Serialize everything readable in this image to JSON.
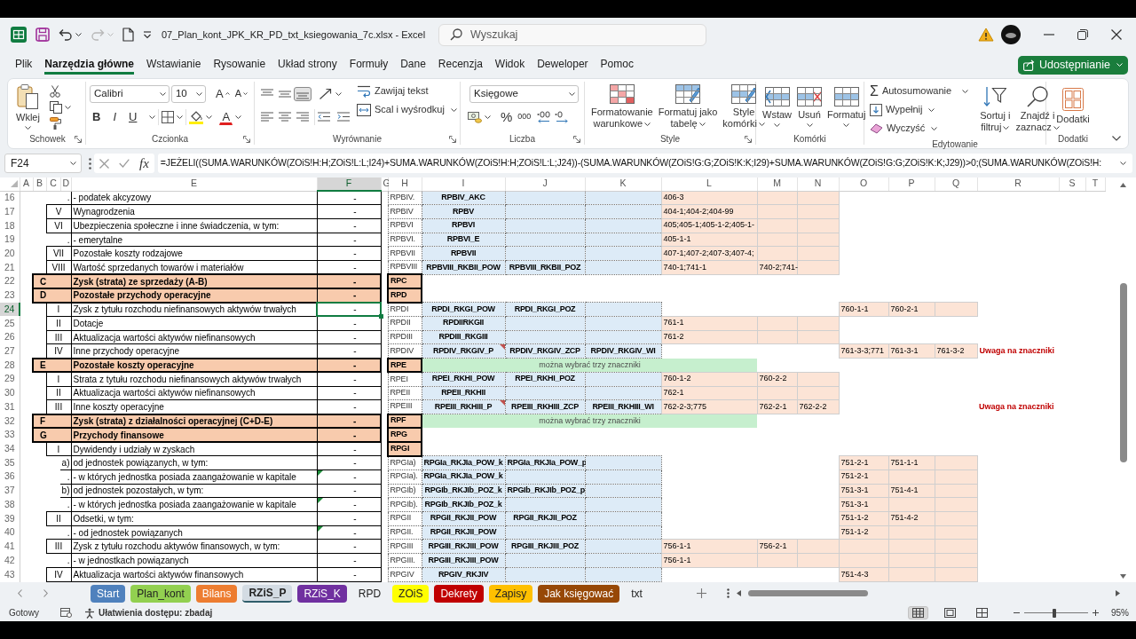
{
  "window": {
    "title": "07_Plan_kont_JPK_KR_PD_txt_ksiegowania_7c.xlsx - Excel"
  },
  "quick_access": [
    {
      "kind": "save",
      "disabled": false
    },
    {
      "kind": "undo",
      "disabled": false
    },
    {
      "kind": "redo",
      "disabled": true
    },
    {
      "kind": "new",
      "disabled": false
    },
    {
      "kind": "customize",
      "disabled": false
    }
  ],
  "search": {
    "placeholder": "Wyszukaj"
  },
  "menu_tabs": [
    {
      "label": "Plik",
      "selected": false
    },
    {
      "label": "Narzędzia główne",
      "selected": true
    },
    {
      "label": "Wstawianie",
      "selected": false
    },
    {
      "label": "Rysowanie",
      "selected": false
    },
    {
      "label": "Układ strony",
      "selected": false
    },
    {
      "label": "Formuły",
      "selected": false
    },
    {
      "label": "Dane",
      "selected": false
    },
    {
      "label": "Recenzja",
      "selected": false
    },
    {
      "label": "Widok",
      "selected": false
    },
    {
      "label": "Deweloper",
      "selected": false
    },
    {
      "label": "Pomoc",
      "selected": false
    }
  ],
  "share_button": {
    "label": "Udostępnianie"
  },
  "ribbon": {
    "clipboard": {
      "label": "Schowek",
      "paste": "Wklej"
    },
    "font": {
      "label": "Czcionka",
      "name": "Calibri",
      "size": "10",
      "grow": "A",
      "shrink": "A",
      "styles": [
        {
          "kind": "bold",
          "glyph": "B"
        },
        {
          "kind": "italic",
          "glyph": "I"
        },
        {
          "kind": "underline",
          "glyph": "U"
        }
      ],
      "font_color": "A"
    },
    "alignment": {
      "label": "Wyrównanie",
      "vertical": [
        {
          "kind": "top",
          "selected": false
        },
        {
          "kind": "middle",
          "selected": false
        },
        {
          "kind": "bottom",
          "selected": true
        }
      ],
      "horizontal": [
        {
          "kind": "left",
          "selected": false
        },
        {
          "kind": "center",
          "selected": false
        },
        {
          "kind": "right",
          "selected": false
        }
      ],
      "wrap": "Zawijaj tekst",
      "merge": "Scal i wyśrodkuj"
    },
    "number": {
      "label": "Liczba",
      "format": "Księgowe",
      "percent": "%",
      "thousands": "000"
    },
    "styles": {
      "label": "Style",
      "buttons": [
        {
          "kind": "conditional",
          "lines": [
            "Formatowanie",
            "warunkowe"
          ]
        },
        {
          "kind": "table",
          "lines": [
            "Formatuj jako",
            "tabelę"
          ]
        },
        {
          "kind": "cell",
          "lines": [
            "Style",
            "komórki"
          ]
        }
      ]
    },
    "cells": {
      "label": "Komórki",
      "buttons": [
        {
          "kind": "insert",
          "label": "Wstaw"
        },
        {
          "kind": "delete",
          "label": "Usuń"
        },
        {
          "kind": "format",
          "label": "Formatuj"
        }
      ]
    },
    "editing": {
      "label": "Edytowanie",
      "sum_symbol": "Σ",
      "autosum": "Autosumowanie",
      "fill": "Wypełnij",
      "clear": "Wyczyść",
      "buttons": [
        {
          "kind": "sort",
          "lines": [
            "Sortuj i",
            "filtruj"
          ]
        },
        {
          "kind": "find",
          "lines": [
            "Znajdź i",
            "zaznacz"
          ]
        }
      ]
    },
    "addins": {
      "label": "Dodatki",
      "button": "Dodatki"
    }
  },
  "formula_bar": {
    "name_box": "F24",
    "fx": "fx",
    "formula": "=JEŻELI((SUMA.WARUNKÓW(ZOiS!H:H;ZOiS!L:L;I24)+SUMA.WARUNKÓW(ZOiS!H:H;ZOiS!L:L;J24))-(SUMA.WARUNKÓW(ZOiS!G:G;ZOiS!K:K;I29)+SUMA.WARUNKÓW(ZOiS!G:G;ZOiS!K:K;J29))>0;(SUMA.WARUNKÓW(ZOiS!H:"
  },
  "sheet": {
    "columns": [
      {
        "label": "A",
        "selected": false
      },
      {
        "label": "B",
        "selected": false
      },
      {
        "label": "C",
        "selected": false
      },
      {
        "label": "D",
        "selected": false
      },
      {
        "label": "E",
        "selected": false
      },
      {
        "label": "F",
        "selected": true
      },
      {
        "label": "G",
        "selected": false
      },
      {
        "label": "H",
        "selected": false
      },
      {
        "label": "I",
        "selected": false
      },
      {
        "label": "J",
        "selected": false
      },
      {
        "label": "K",
        "selected": false
      },
      {
        "label": "L",
        "selected": false
      },
      {
        "label": "M",
        "selected": false
      },
      {
        "label": "N",
        "selected": false
      },
      {
        "label": "O",
        "selected": false
      },
      {
        "label": "P",
        "selected": false
      },
      {
        "label": "Q",
        "selected": false
      },
      {
        "label": "R",
        "selected": false
      },
      {
        "label": "S",
        "selected": false
      },
      {
        "label": "T",
        "selected": false
      }
    ],
    "rows": [
      {
        "number": "16",
        "selected": false,
        "kind": "sub",
        "label": ".",
        "title": "- podatek akcyzowy",
        "value": "-",
        "code": {
          "kind": "leaf",
          "text": "RPBIV."
        },
        "blocks": [
          {
            "kind": "markers",
            "values": [
              "RPBIV_AKC"
            ]
          },
          {
            "kind": "accounts",
            "values": [
              "406-3"
            ]
          }
        ],
        "comment_mark": false,
        "error_mark": false
      },
      {
        "number": "17",
        "selected": false,
        "kind": "item",
        "label": "V",
        "title": "Wynagrodzenia",
        "value": "-",
        "code": {
          "kind": "leaf",
          "text": "RPBIV"
        },
        "blocks": [
          {
            "kind": "markers",
            "values": [
              "RPBV"
            ]
          },
          {
            "kind": "accounts",
            "values": [
              "404-1;404-2;404-99"
            ]
          }
        ],
        "comment_mark": false,
        "error_mark": false
      },
      {
        "number": "18",
        "selected": false,
        "kind": "item",
        "label": "VI",
        "title": "Ubezpieczenia społeczne i inne świadczenia, w tym:",
        "value": "-",
        "code": {
          "kind": "leaf",
          "text": "RPBVI"
        },
        "blocks": [
          {
            "kind": "markers",
            "values": [
              "RPBVI"
            ]
          },
          {
            "kind": "accounts",
            "values": [
              "405;405-1;405-1-2;405-1-"
            ]
          }
        ],
        "comment_mark": false,
        "error_mark": false
      },
      {
        "number": "19",
        "selected": false,
        "kind": "sub",
        "label": ".",
        "title": "- emerytalne",
        "value": "-",
        "code": {
          "kind": "leaf",
          "text": "RPBVI."
        },
        "blocks": [
          {
            "kind": "markers",
            "values": [
              "RPBVI_E"
            ]
          },
          {
            "kind": "accounts",
            "values": [
              "405-1-1"
            ]
          }
        ],
        "comment_mark": false,
        "error_mark": false
      },
      {
        "number": "20",
        "selected": false,
        "kind": "item",
        "label": "VII",
        "title": "Pozostałe koszty rodzajowe",
        "value": "-",
        "code": {
          "kind": "leaf",
          "text": "RPBVII"
        },
        "blocks": [
          {
            "kind": "markers",
            "values": [
              "RPBVII"
            ]
          },
          {
            "kind": "accounts",
            "values": [
              "407-1;407-2;407-3;407-4;"
            ]
          }
        ],
        "comment_mark": false,
        "error_mark": false
      },
      {
        "number": "21",
        "selected": false,
        "kind": "item",
        "label": "VIII",
        "title": "Wartość sprzedanych towarów i materiałów",
        "value": "-",
        "code": {
          "kind": "leaf",
          "text": "RPBVIII"
        },
        "blocks": [
          {
            "kind": "markers",
            "values": [
              "RPBVIII_RKBII_POW",
              "RPBVIII_RKBII_POZ"
            ]
          },
          {
            "kind": "accounts",
            "values": [
              "740-1;741-1",
              "740-2;741-"
            ]
          }
        ],
        "comment_mark": false,
        "error_mark": false
      },
      {
        "number": "22",
        "selected": false,
        "kind": "section",
        "label": "C",
        "title": "Zysk (strata) ze sprzedaży (A-B)",
        "value": "-",
        "code": {
          "kind": "group",
          "text": "RPC"
        },
        "comment_mark": false,
        "error_mark": false
      },
      {
        "number": "23",
        "selected": false,
        "kind": "section",
        "label": "D",
        "title": "Pozostałe przychody operacyjne",
        "value": "-",
        "code": {
          "kind": "group",
          "text": "RPD"
        },
        "comment_mark": false,
        "error_mark": false
      },
      {
        "number": "24",
        "selected": true,
        "kind": "item",
        "label": "I",
        "title": "Zysk z tytułu rozchodu niefinansowych aktywów trwałych",
        "value": "-",
        "code": {
          "kind": "leaf",
          "text": "RPDI"
        },
        "blocks": [
          {
            "kind": "markers",
            "values": [
              "RPDI_RKGI_POW",
              "RPDI_RKGI_POZ"
            ]
          },
          {
            "kind": "accounts_extra",
            "values": [
              "760-1-1",
              "760-2-1"
            ]
          }
        ],
        "comment_mark": false,
        "error_mark": false
      },
      {
        "number": "25",
        "selected": false,
        "kind": "item",
        "label": "II",
        "title": "Dotacje",
        "value": "-",
        "code": {
          "kind": "leaf",
          "text": "RPDII"
        },
        "blocks": [
          {
            "kind": "markers",
            "values": [
              "RPDIIRKGII"
            ]
          },
          {
            "kind": "accounts",
            "values": [
              "761-1"
            ]
          }
        ],
        "comment_mark": false,
        "error_mark": false
      },
      {
        "number": "26",
        "selected": false,
        "kind": "item",
        "label": "III",
        "title": "Aktualizacja wartości aktywów niefinansowych",
        "value": "-",
        "code": {
          "kind": "leaf",
          "text": "RPDIII"
        },
        "blocks": [
          {
            "kind": "markers",
            "values": [
              "RPDIII_RKGIII"
            ]
          },
          {
            "kind": "accounts",
            "values": [
              "761-2"
            ]
          }
        ],
        "comment_mark": false,
        "error_mark": false
      },
      {
        "number": "27",
        "selected": false,
        "kind": "item",
        "label": "IV",
        "title": "Inne przychody operacyjne",
        "value": "-",
        "code": {
          "kind": "leaf",
          "text": "RPDIV"
        },
        "blocks": [
          {
            "kind": "markers",
            "values": [
              "RPDIV_RKGIV_P",
              "RPDIV_RKGIV_ZCP",
              "RPDIV_RKGIV_WI"
            ]
          },
          {
            "kind": "accounts_extra",
            "values": [
              "761-3-3;771",
              "761-3-1",
              "761-3-2"
            ]
          }
        ],
        "warning": "Uwaga na znaczniki",
        "comment_mark": true,
        "error_mark": false
      },
      {
        "number": "28",
        "selected": false,
        "kind": "section",
        "label": "E",
        "title": "Pozostałe koszty operacyjne",
        "value": "-",
        "code": {
          "kind": "group",
          "text": "RPE"
        },
        "note": "można wybrać trzy znaczniki",
        "comment_mark": false,
        "error_mark": false
      },
      {
        "number": "29",
        "selected": false,
        "kind": "item",
        "label": "I",
        "title": "Strata z tytułu rozchodu niefinansowych aktywów trwałych",
        "value": "-",
        "code": {
          "kind": "leaf",
          "text": "RPEI"
        },
        "blocks": [
          {
            "kind": "markers",
            "values": [
              "RPEI_RKHI_POW",
              "RPEI_RKHI_POZ"
            ]
          },
          {
            "kind": "accounts",
            "values": [
              "760-1-2",
              "760-2-2"
            ]
          }
        ],
        "comment_mark": false,
        "error_mark": false
      },
      {
        "number": "30",
        "selected": false,
        "kind": "item",
        "label": "II",
        "title": "Aktualizacja wartości aktywów niefinansowych",
        "value": "-",
        "code": {
          "kind": "leaf",
          "text": "RPEII"
        },
        "blocks": [
          {
            "kind": "markers",
            "values": [
              "RPEII_RKHII"
            ]
          },
          {
            "kind": "accounts",
            "values": [
              "762-1"
            ]
          }
        ],
        "comment_mark": false,
        "error_mark": false
      },
      {
        "number": "31",
        "selected": false,
        "kind": "item",
        "label": "III",
        "title": "Inne koszty operacyjne",
        "value": "-",
        "code": {
          "kind": "leaf",
          "text": "RPEIII"
        },
        "blocks": [
          {
            "kind": "markers",
            "values": [
              "RPEIII_RKHIII_P",
              "RPEIII_RKHIII_ZCP",
              "RPEIII_RKHIII_WI"
            ]
          },
          {
            "kind": "accounts",
            "values": [
              "762-2-3;775",
              "762-2-1",
              "762-2-2"
            ]
          }
        ],
        "warning": "Uwaga na znaczniki",
        "comment_mark": true,
        "error_mark": false
      },
      {
        "number": "32",
        "selected": false,
        "kind": "section",
        "label": "F",
        "title": "Zysk (strata) z działalności operacyjnej (C+D-E)",
        "value": "-",
        "code": {
          "kind": "group",
          "text": "RPF"
        },
        "note": "można wybrać trzy znaczniki",
        "comment_mark": false,
        "error_mark": false
      },
      {
        "number": "33",
        "selected": false,
        "kind": "section",
        "label": "G",
        "title": "Przychody finansowe",
        "value": "-",
        "code": {
          "kind": "group",
          "text": "RPG"
        },
        "comment_mark": false,
        "error_mark": false
      },
      {
        "number": "34",
        "selected": false,
        "kind": "item",
        "label": "I",
        "title": "Dywidendy i udziały w zyskach",
        "value": "-",
        "code": {
          "kind": "group",
          "text": "RPGI"
        },
        "comment_mark": false,
        "error_mark": false
      },
      {
        "number": "35",
        "selected": false,
        "kind": "sub",
        "label": "a)",
        "title": "od jednostek powiązanych, w tym:",
        "value": "-",
        "code": {
          "kind": "leaf",
          "text": "RPGIa)"
        },
        "blocks": [
          {
            "kind": "markers",
            "values": [
              "RPGIa_RKJIa_POW_k",
              "RPGIa_RKJIa_POW_p"
            ]
          },
          {
            "kind": "accounts_extra",
            "values": [
              "751-2-1",
              "751-1-1"
            ]
          }
        ],
        "comment_mark": false,
        "error_mark": false
      },
      {
        "number": "36",
        "selected": false,
        "kind": "sub",
        "label": ".",
        "title": "- w których jednostka posiada zaangażowanie w kapitale",
        "value": "-",
        "code": {
          "kind": "leaf",
          "text": "RPGIa)."
        },
        "blocks": [
          {
            "kind": "markers",
            "values": [
              "RPGIa_RKJIa_POW_k"
            ]
          },
          {
            "kind": "accounts_extra",
            "values": [
              "751-2-1"
            ]
          }
        ],
        "comment_mark": false,
        "error_mark": true
      },
      {
        "number": "37",
        "selected": false,
        "kind": "sub",
        "label": "b)",
        "title": "od jednostek pozostałych, w tym:",
        "value": "-",
        "code": {
          "kind": "leaf",
          "text": "RPGIb)"
        },
        "blocks": [
          {
            "kind": "markers",
            "values": [
              "RPGIb_RKJIb_POZ_k",
              "RPGIb_RKJIb_POZ_p"
            ]
          },
          {
            "kind": "accounts_extra",
            "values": [
              "751-3-1",
              "751-4-1"
            ]
          }
        ],
        "comment_mark": false,
        "error_mark": false
      },
      {
        "number": "38",
        "selected": false,
        "kind": "sub",
        "label": ".",
        "title": "- w których jednostka posiada zaangażowanie w kapitale",
        "value": "-",
        "code": {
          "kind": "leaf",
          "text": "RPGIb)."
        },
        "blocks": [
          {
            "kind": "markers",
            "values": [
              "RPGIb_RKJIb_POZ_k"
            ]
          },
          {
            "kind": "accounts_extra",
            "values": [
              "751-3-1"
            ]
          }
        ],
        "comment_mark": false,
        "error_mark": true
      },
      {
        "number": "39",
        "selected": false,
        "kind": "item",
        "label": "II",
        "title": "Odsetki, w tym:",
        "value": "-",
        "code": {
          "kind": "leaf",
          "text": "RPGII"
        },
        "blocks": [
          {
            "kind": "markers",
            "values": [
              "RPGII_RKJII_POW",
              "RPGII_RKJII_POZ"
            ]
          },
          {
            "kind": "accounts_extra",
            "values": [
              "751-1-2",
              "751-4-2"
            ]
          }
        ],
        "comment_mark": false,
        "error_mark": false
      },
      {
        "number": "40",
        "selected": false,
        "kind": "sub",
        "label": ".",
        "title": "- od jednostek powiązanych",
        "value": "-",
        "code": {
          "kind": "leaf",
          "text": "RPGII."
        },
        "blocks": [
          {
            "kind": "markers",
            "values": [
              "RPGII_RKJII_POW"
            ]
          },
          {
            "kind": "accounts_extra",
            "values": [
              "751-1-2"
            ]
          }
        ],
        "comment_mark": false,
        "error_mark": true
      },
      {
        "number": "41",
        "selected": false,
        "kind": "item",
        "label": "III",
        "title": "Zysk z tytułu rozchodu aktywów finansowych, w tym:",
        "value": "-",
        "code": {
          "kind": "leaf",
          "text": "RPGIII"
        },
        "blocks": [
          {
            "kind": "markers",
            "values": [
              "RPGIII_RKJIII_POW",
              "RPGIII_RKJIII_POZ"
            ]
          },
          {
            "kind": "accounts",
            "values": [
              "756-1-1",
              "756-2-1"
            ]
          },
          {
            "kind": "accounts_extra"
          }
        ],
        "comment_mark": false,
        "error_mark": false
      },
      {
        "number": "42",
        "selected": false,
        "kind": "sub",
        "label": ".",
        "title": "- w jednostkach powiązanych",
        "value": "-",
        "code": {
          "kind": "leaf",
          "text": "RPGIII."
        },
        "blocks": [
          {
            "kind": "markers",
            "values": [
              "RPGIII_RKJIII_POW"
            ]
          },
          {
            "kind": "accounts",
            "values": [
              "756-1-1"
            ]
          },
          {
            "kind": "accounts_extra"
          }
        ],
        "comment_mark": false,
        "error_mark": false
      },
      {
        "number": "43",
        "selected": false,
        "kind": "item",
        "label": "IV",
        "title": "Aktualizacja wartości aktywów finansowych",
        "value": "-",
        "code": {
          "kind": "leaf",
          "text": "RPGIV"
        },
        "blocks": [
          {
            "kind": "markers",
            "values": [
              "RPGIV_RKJIV"
            ]
          },
          {
            "kind": "accounts_extra",
            "values": [
              "751-4-3"
            ]
          }
        ],
        "comment_mark": false,
        "error_mark": false
      }
    ]
  },
  "sheet_tabs": [
    {
      "label": "Start",
      "color": "#4f81bd",
      "selected": false
    },
    {
      "label": "Plan_kont",
      "color": "#92d050",
      "selected": false
    },
    {
      "label": "Bilans",
      "color": "#ed7d31",
      "selected": false
    },
    {
      "label": "RZiS_P",
      "selected": true
    },
    {
      "label": "RZiS_K",
      "color": "#7030a0",
      "selected": false
    },
    {
      "label": "RPD",
      "selected": false
    },
    {
      "label": "ZOiS",
      "color": "#ffff00",
      "selected": false
    },
    {
      "label": "Dekrety",
      "color": "#c00000",
      "selected": false
    },
    {
      "label": "Zapisy",
      "color": "#ffc000",
      "selected": false
    },
    {
      "label": "Jak księgować",
      "color": "#974806",
      "selected": false
    },
    {
      "label": "txt",
      "selected": false
    }
  ],
  "status_bar": {
    "state": "Gotowy",
    "accessibility": "Ułatwienia dostępu: zbadaj",
    "views": [
      {
        "kind": "normal",
        "selected": true
      },
      {
        "kind": "page_layout",
        "selected": false
      },
      {
        "kind": "page_break",
        "selected": false
      }
    ],
    "zoom": {
      "level": 0.47,
      "label": "95%"
    }
  }
}
